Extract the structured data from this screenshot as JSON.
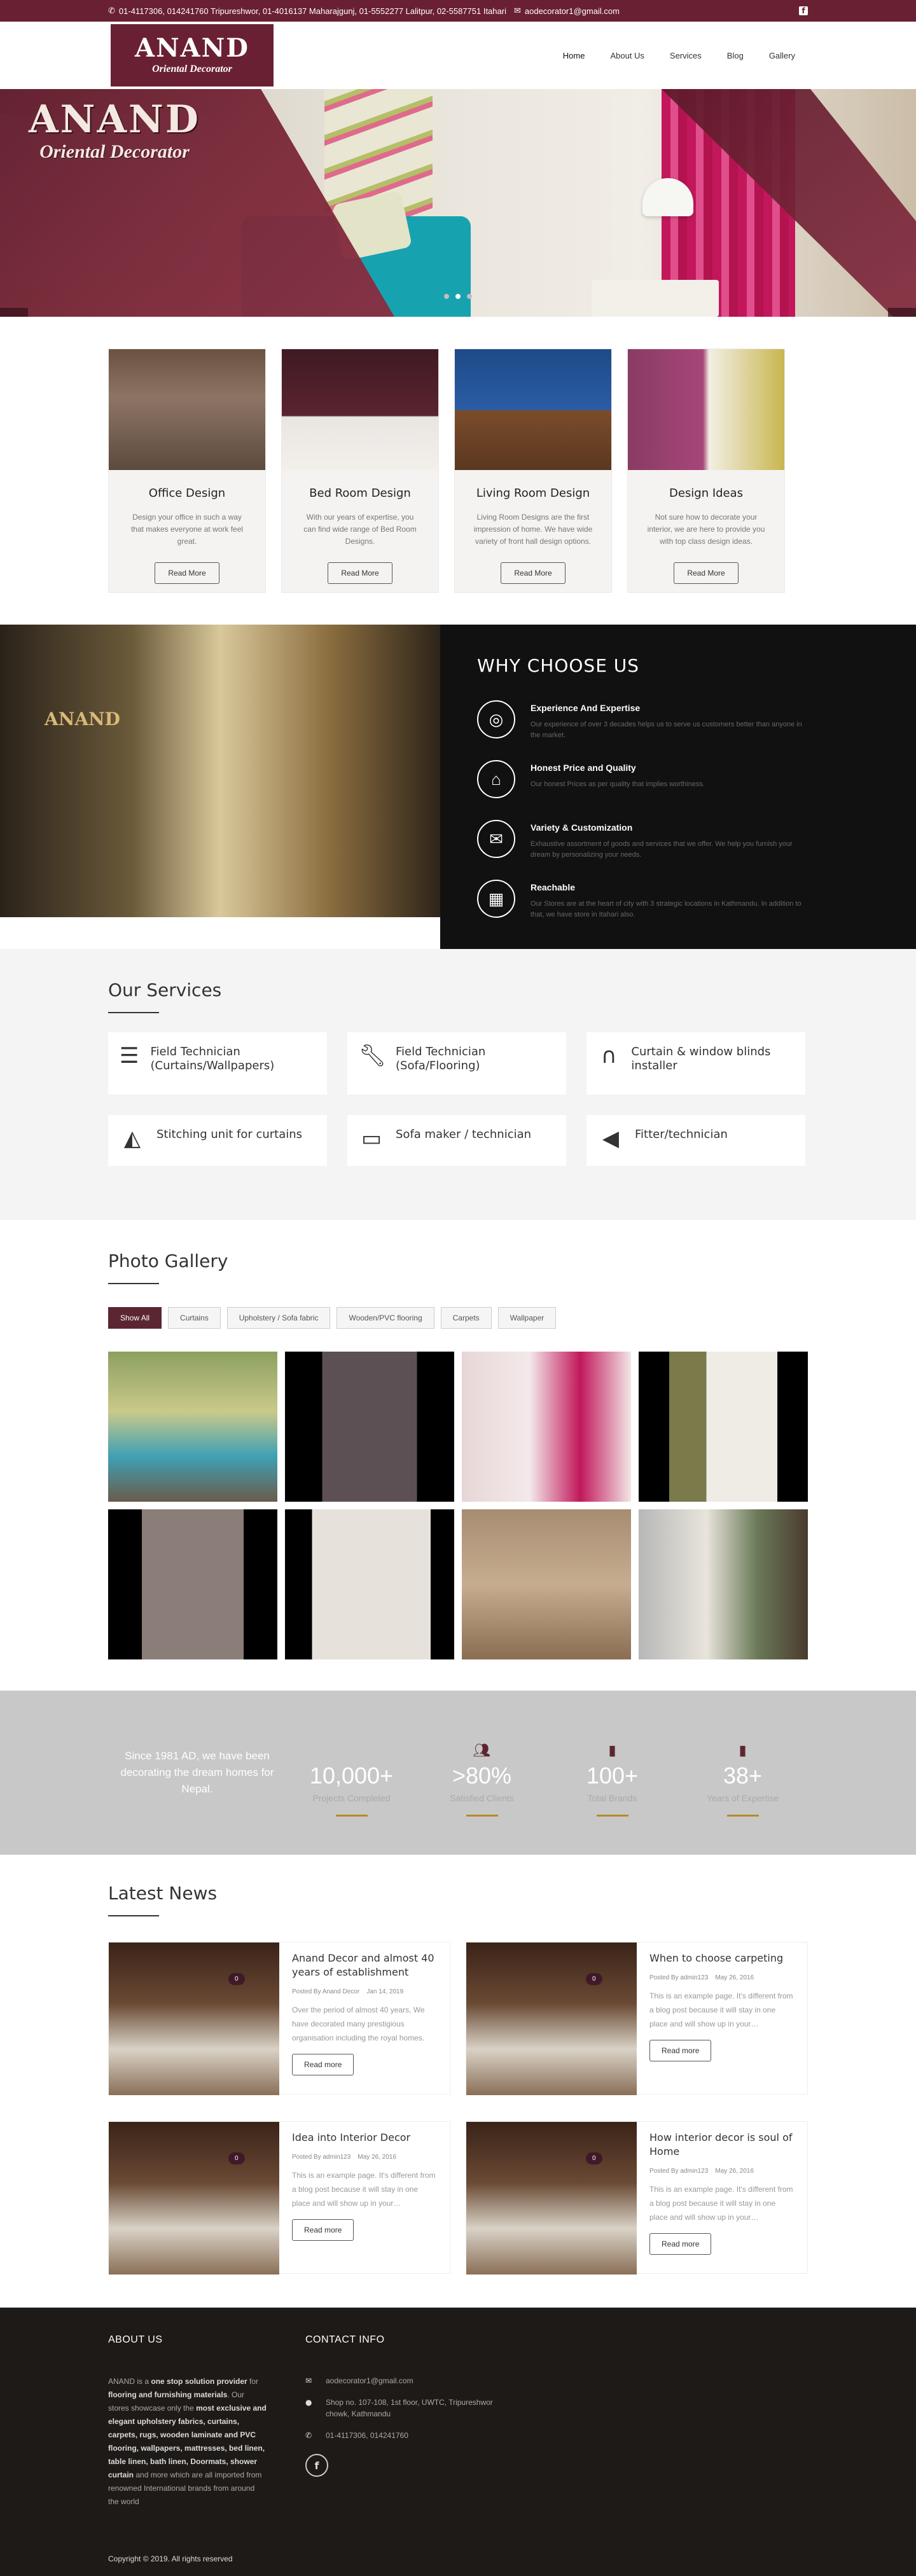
{
  "topbar": {
    "phones": "01-4117306, 014241760 Tripureshwor, 01-4016137 Maharajgunj, 01-5552277 Lalitpur, 02-5587751 Itahari",
    "email": "aodecorator1@gmail.com",
    "phone_icon": "phone-icon",
    "email_icon": "envelope-icon",
    "social_icon": "facebook-icon"
  },
  "brand": {
    "name": "ANAND",
    "tagline": "Oriental Decorator",
    "color": "#6a2033"
  },
  "nav": {
    "items": [
      "Home",
      "About Us",
      "Services",
      "Blog",
      "Gallery"
    ]
  },
  "hero": {
    "logo_name": "ANAND",
    "logo_tagline": "Oriental Decorator",
    "slide_count": 3,
    "active_slide": 2
  },
  "cards": [
    {
      "title": "Office Design",
      "text": "Design your office in such a way that makes everyone at work feel great.",
      "button": "Read More"
    },
    {
      "title": "Bed Room Design",
      "text": "With our years of expertise, you can find wide range of Bed Room Designs.",
      "button": "Read More"
    },
    {
      "title": "Living Room Design",
      "text": "Living Room Designs are the first impression of home. We have wide variety of front hall design options.",
      "button": "Read More"
    },
    {
      "title": "Design Ideas",
      "text": "Not sure how to decorate your interior, we are here to provide you with top class design ideas.",
      "button": "Read More"
    }
  ],
  "why": {
    "heading": "WHY CHOOSE US",
    "photo_word": "ANAND",
    "items": [
      {
        "icon": "target-icon",
        "title": "Experience And Expertise",
        "text": "Our experience of over 3 decades helps us to serve us customers better than anyone in the market."
      },
      {
        "icon": "home-icon",
        "title": "Honest Price and Quality",
        "text": "Our honest Prices as per quality that implies worthiness."
      },
      {
        "icon": "envelope-icon",
        "title": "Variety & Customization",
        "text": "Exhaustive assortment of goods and services that we offer. We help you furnish your dream by personalizing your needs."
      },
      {
        "icon": "building-icon",
        "title": "Reachable",
        "text": "Our Stores are at the heart of city with 3 strategic locations in Kathmandu. In addition to that, we have store in Itahari also."
      }
    ]
  },
  "services": {
    "heading": "Our Services",
    "items": [
      {
        "icon": "menu-bars-icon",
        "label": "Field Technician (Curtains/Wallpapers)"
      },
      {
        "icon": "wrench-icon",
        "label": "Field Technician (Sofa/Flooring)"
      },
      {
        "icon": "headphones-icon",
        "label": "Curtain & window blinds installer"
      },
      {
        "icon": "area-chart-icon",
        "label": "Stitching unit for curtains"
      },
      {
        "icon": "laptop-icon",
        "label": "Sofa maker / technician"
      },
      {
        "icon": "megaphone-icon",
        "label": "Fitter/technician"
      }
    ]
  },
  "gallery": {
    "heading": "Photo Gallery",
    "filters": [
      "Show All",
      "Curtains",
      "Upholstery / Sofa fabric",
      "Wooden/PVC flooring",
      "Carpets",
      "Wallpaper"
    ],
    "active_filter": "Show All",
    "photo_count": 8
  },
  "stats": {
    "tagline": "Since 1981 AD, we have been decorating the dream homes for Nepal.",
    "items": [
      {
        "icon": "",
        "value": "10,000+",
        "label": "Projects Completed"
      },
      {
        "icon": "users-icon",
        "value": ">80%",
        "label": "Satisfied Clients"
      },
      {
        "icon": "book-icon",
        "value": "100+",
        "label": "Total Brands"
      },
      {
        "icon": "book-icon",
        "value": "38+",
        "label": "Years of Expertise"
      }
    ],
    "accent_color": "#b8892b"
  },
  "news": {
    "heading": "Latest News",
    "posts": [
      {
        "title": "Anand Decor and almost 40 years of establishment",
        "author": "Posted By Anand Decor",
        "date": "Jan 14, 2019",
        "excerpt": "Over the period of almost 40 years, We have decorated many prestigious organisation including the royal homes.",
        "button": "Read more",
        "badge": "0"
      },
      {
        "title": "When to choose carpeting",
        "author": "Posted By admin123",
        "date": "May 26, 2016",
        "excerpt": "This is an example page. It's different from a blog post because it will stay in one place and will show up in your…",
        "button": "Read more",
        "badge": "0"
      },
      {
        "title": "Idea into Interior Decor",
        "author": "Posted By admin123",
        "date": "May 26, 2016",
        "excerpt": "This is an example page. It's different from a blog post because it will stay in one place and will show up in your…",
        "button": "Read more",
        "badge": "0"
      },
      {
        "title": "How interior decor is soul of Home",
        "author": "Posted By admin123",
        "date": "May 26, 2016",
        "excerpt": "This is an example page. It's different from a blog post because it will stay in one place and will show up in your…",
        "button": "Read more",
        "badge": "0"
      }
    ]
  },
  "footer": {
    "about_heading": "ABOUT US",
    "about_parts": [
      {
        "t": "ANAND is a ",
        "b": false
      },
      {
        "t": "one stop solution provider",
        "b": true
      },
      {
        "t": " for ",
        "b": false
      },
      {
        "t": "flooring and furnishing materials",
        "b": true
      },
      {
        "t": ". Our stores showcase only the ",
        "b": false
      },
      {
        "t": "most exclusive and elegant upholstery fabrics, curtains, carpets, rugs, wooden laminate and PVC flooring, wallpapers, mattresses, bed linen, table linen, bath linen, Doormats, shower curtain",
        "b": true
      },
      {
        "t": " and more which are all imported from renowned International brands from around the world",
        "b": false
      }
    ],
    "contact_heading": "CONTACT INFO",
    "email": "aodecorator1@gmail.com",
    "address": "Shop no. 107-108, 1st floor, UWTC, Tripureshwor chowk, Kathmandu",
    "phone": "01-4117306, 014241760",
    "copyright": "Copyright © 2019. All rights reserved"
  }
}
